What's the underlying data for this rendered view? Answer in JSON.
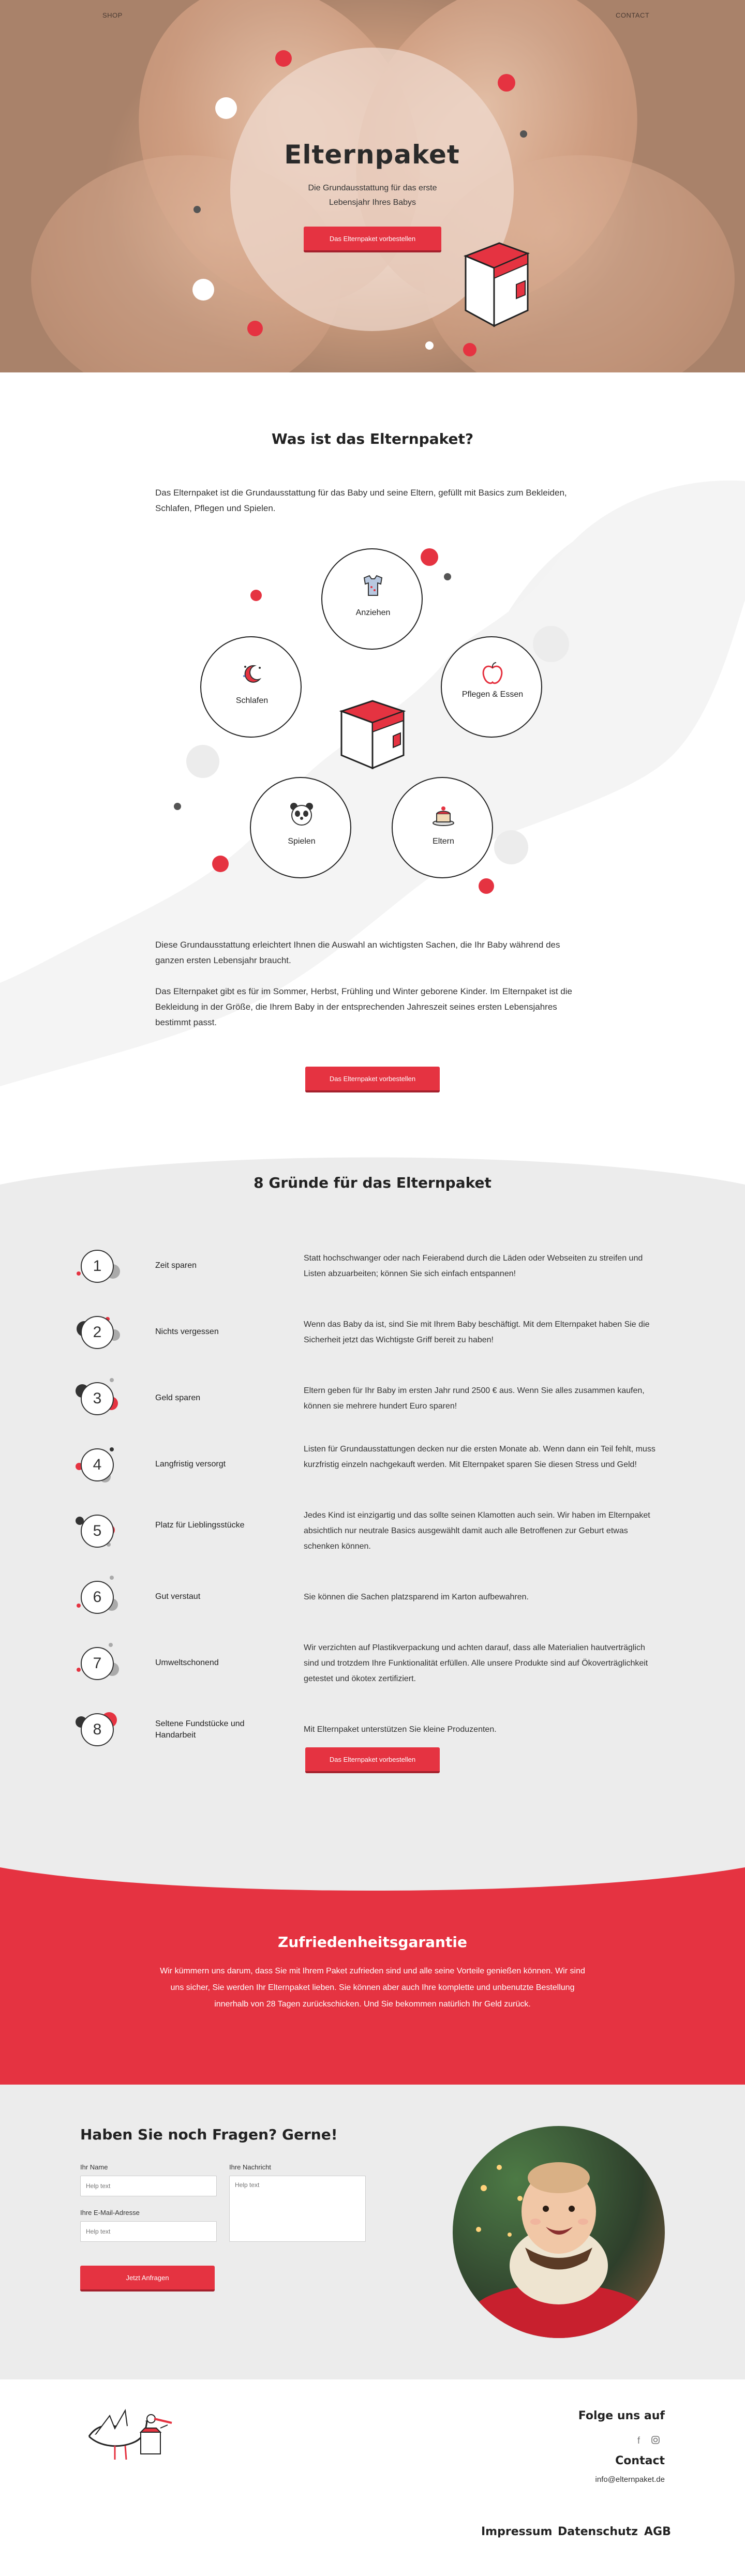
{
  "nav": {
    "shop": "SHOP",
    "contact": "CONTACT"
  },
  "hero": {
    "title": "Elternpaket",
    "subtitle": "Die Grundausstattung für das erste Lebensjahr Ihres Babys",
    "cta": "Das Elternpaket vorbestellen"
  },
  "what": {
    "title": "Was ist das Elternpaket?",
    "intro": "Das Elternpaket ist die Grundausstattung für das Baby und seine Eltern, gefüllt mit Basics zum Bekleiden, Schlafen, Pflegen und Spielen.",
    "items": [
      {
        "label": "Anziehen",
        "icon": "clothes-icon"
      },
      {
        "label": "Schlafen",
        "icon": "moon-stars-icon"
      },
      {
        "label": "Pflegen & Essen",
        "icon": "apple-icon"
      },
      {
        "label": "Spielen",
        "icon": "panda-icon"
      },
      {
        "label": "Eltern",
        "icon": "cake-icon"
      }
    ],
    "para1": "Diese Grundausstattung erleichtert Ihnen die Auswahl an wichtigsten Sachen, die Ihr Baby während des ganzen ersten Lebensjahr braucht.",
    "para2": "Das Elternpaket gibt es für im Sommer, Herbst, Frühling und Winter geborene Kinder. Im Elternpaket ist die Bekleidung in der Größe, die Ihrem Baby in der entsprechenden Jahreszeit seines ersten Lebensjahres bestimmt passt.",
    "cta": "Das Elternpaket vorbestellen"
  },
  "reasons": {
    "title": "8 Gründe für das Elternpaket",
    "items": [
      {
        "num": "1",
        "name": "Zeit sparen",
        "desc": "Statt hochschwanger oder nach Feierabend durch die Läden oder Webseiten zu streifen und Listen abzuarbeiten; können Sie sich einfach entspannen!"
      },
      {
        "num": "2",
        "name": "Nichts vergessen",
        "desc": "Wenn das Baby da ist, sind Sie mit Ihrem Baby beschäftigt. Mit dem Elternpaket haben Sie die Sicherheit jetzt das Wichtigste Griff bereit zu haben!"
      },
      {
        "num": "3",
        "name": "Geld sparen",
        "desc": "Eltern geben für Ihr Baby im ersten Jahr rund 2500 € aus. Wenn Sie alles zusammen kaufen, können sie mehrere hundert Euro sparen!"
      },
      {
        "num": "4",
        "name": "Langfristig versorgt",
        "desc": "Listen für Grundausstattungen decken nur die ersten Monate ab. Wenn dann ein Teil fehlt, muss kurzfristig einzeln nachgekauft werden. Mit Elternpaket sparen Sie diesen Stress und Geld!"
      },
      {
        "num": "5",
        "name": "Platz für Lieblingsstücke",
        "desc": "Jedes Kind ist einzigartig und das sollte seinen Klamotten auch sein. Wir haben im Elternpaket absichtlich nur neutrale Basics ausgewählt damit auch alle Betroffenen zur Geburt etwas schenken können."
      },
      {
        "num": "6",
        "name": "Gut verstaut",
        "desc": "Sie können die Sachen platzsparend im Karton aufbewahren."
      },
      {
        "num": "7",
        "name": "Umweltschonend",
        "desc": "Wir verzichten auf Plastikverpackung und achten darauf, dass alle Materialien hautverträglich sind und trotzdem Ihre Funktionalität erfüllen. Alle unsere Produkte sind auf Ökoverträglichkeit getestet und ökotex zertifiziert."
      },
      {
        "num": "8",
        "name": "Seltene Fundstücke und Handarbeit",
        "desc": "Mit Elternpaket unterstützen Sie kleine Produzenten."
      }
    ],
    "cta": "Das Elternpaket vorbestellen"
  },
  "guarantee": {
    "title": "Zufriedenheitsgarantie",
    "text": "Wir kümmern uns darum, dass Sie mit Ihrem Paket zufrieden sind und alle seine Vorteile genießen können. Wir sind uns sicher, Sie werden Ihr Elternpaket lieben. Sie können aber auch Ihre komplette und unbenutzte Bestellung innerhalb von 28 Tagen zurückschicken. Und Sie bekommen natürlich Ihr Geld zurück."
  },
  "contact": {
    "title": "Haben Sie noch Fragen? Gerne!",
    "name_label": "Ihr Name",
    "name_placeholder": "Help text",
    "email_label": "Ihre E-Mail-Adresse",
    "email_placeholder": "Help text",
    "message_label": "Ihre Nachricht",
    "message_placeholder": "Help text",
    "submit": "Jetzt Anfragen"
  },
  "footer": {
    "follow": "Folge uns auf",
    "contact_heading": "Contact",
    "email": "info@elternpaket.de",
    "links": [
      "Impressum",
      "Datenschutz",
      "AGB"
    ]
  },
  "colors": {
    "accent": "#e53341",
    "accent_dark": "#a4212d",
    "grey_bg": "#ececec",
    "text": "#333333"
  }
}
